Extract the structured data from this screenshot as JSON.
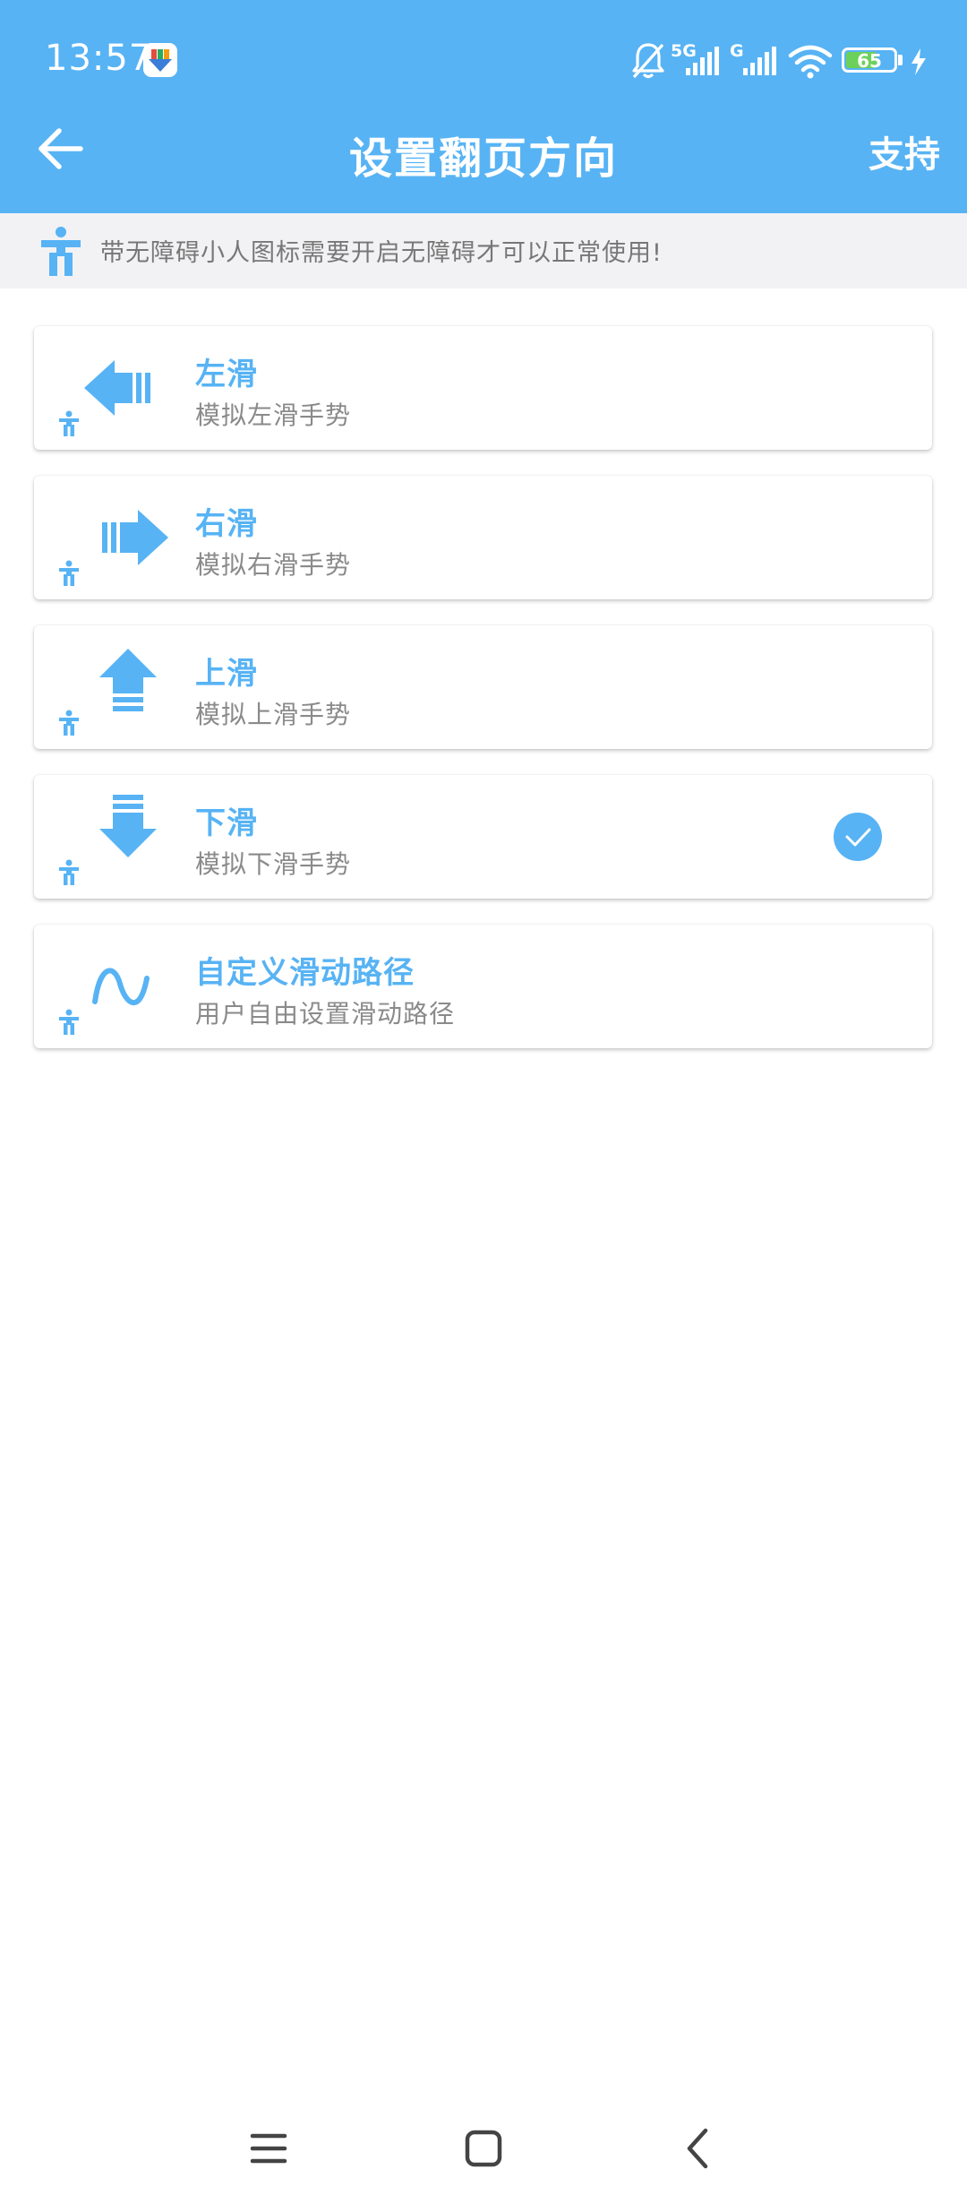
{
  "status_bar": {
    "time": "13:57",
    "network_1": "5G",
    "network_2": "G",
    "battery": "65",
    "battery_level": 0.65,
    "icons": [
      "app-notification-icon",
      "mute-bell-icon",
      "signal-icon",
      "signal-icon",
      "wifi-icon",
      "battery-icon",
      "charging-icon"
    ]
  },
  "app_bar": {
    "title": "设置翻页方向",
    "back_icon": "arrow-left-icon",
    "action_label": "支持"
  },
  "notice": {
    "icon": "accessibility-icon",
    "text": "带无障碍小人图标需要开启无障碍才可以正常使用!"
  },
  "options": [
    {
      "title": "左滑",
      "description": "模拟左滑手势",
      "icon": "arrow-left-swipe-icon",
      "selected": false
    },
    {
      "title": "右滑",
      "description": "模拟右滑手势",
      "icon": "arrow-right-swipe-icon",
      "selected": false
    },
    {
      "title": "上滑",
      "description": "模拟上滑手势",
      "icon": "arrow-up-swipe-icon",
      "selected": false
    },
    {
      "title": "下滑",
      "description": "模拟下滑手势",
      "icon": "arrow-down-swipe-icon",
      "selected": true
    },
    {
      "title": "自定义滑动路径",
      "description": "用户自由设置滑动路径",
      "icon": "wave-path-icon",
      "selected": false
    }
  ],
  "nav_bar": {
    "icons": [
      "menu-icon",
      "home-icon",
      "back-icon"
    ]
  },
  "colors": {
    "primary": "#57b3f4",
    "notice_bg": "#f2f2f4",
    "battery_green": "#6cd15a"
  }
}
